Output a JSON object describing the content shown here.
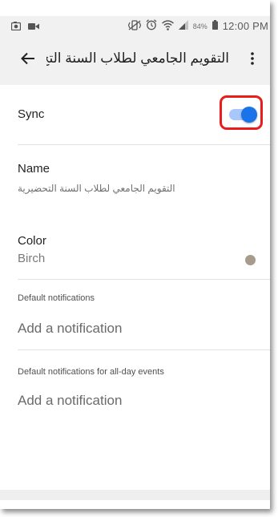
{
  "status_bar": {
    "battery_percent": "84%",
    "time": "12:00 PM",
    "icons": [
      "screenshot-icon",
      "video-icon",
      "mute-vibrate-icon",
      "alarm-icon",
      "wifi-icon",
      "signal-icon",
      "battery-icon"
    ]
  },
  "app_bar": {
    "title": "التقويم الجامعي لطلاب السنة التح...",
    "back_icon": "arrow-back-icon",
    "more_icon": "more-vertical-icon"
  },
  "sync": {
    "label": "Sync",
    "enabled": true,
    "accent_color": "#1a73e8",
    "highlight_color": "#ea1c1c"
  },
  "name": {
    "label": "Name",
    "value": "التقويم الجامعي لطلاب السنة التحضيرية"
  },
  "color": {
    "label": "Color",
    "value": "Birch",
    "swatch": "#a79b8e"
  },
  "default_notifications": {
    "heading": "Default notifications",
    "add_label": "Add a notification"
  },
  "allday_notifications": {
    "heading": "Default notifications for all-day events",
    "add_label": "Add a notification"
  }
}
